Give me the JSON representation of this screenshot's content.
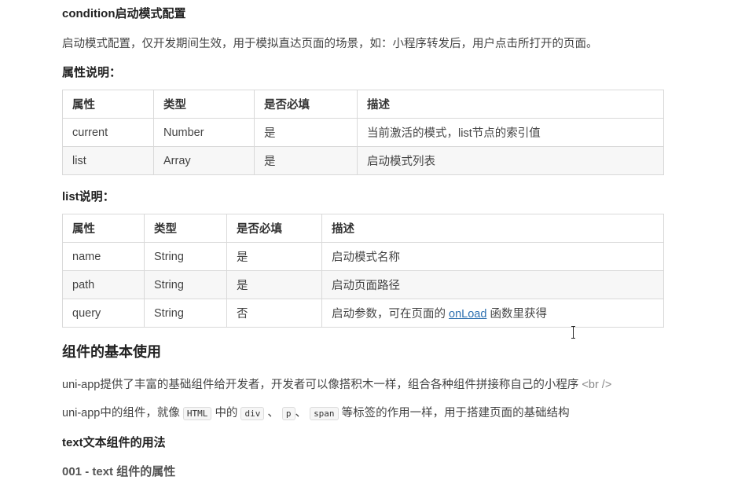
{
  "section1": {
    "title": "condition启动模式配置",
    "desc": "启动模式配置，仅开发期间生效，用于模拟直达页面的场景，如：小程序转发后，用户点击所打开的页面。",
    "attr_heading": "属性说明：",
    "table": {
      "headers": [
        "属性",
        "类型",
        "是否必填",
        "描述"
      ],
      "rows": [
        [
          "current",
          "Number",
          "是",
          "当前激活的模式，list节点的索引值"
        ],
        [
          "list",
          "Array",
          "是",
          "启动模式列表"
        ]
      ]
    }
  },
  "section2": {
    "heading": "list说明：",
    "table": {
      "headers": [
        "属性",
        "类型",
        "是否必填",
        "描述"
      ],
      "rows": [
        [
          "name",
          "String",
          "是",
          "启动模式名称"
        ],
        [
          "path",
          "String",
          "是",
          "启动页面路径"
        ],
        [
          "query",
          "String",
          "否",
          "启动参数，可在页面的",
          "onLoad",
          "函数里获得"
        ]
      ]
    }
  },
  "section3": {
    "title": "组件的基本使用",
    "para1": "uni-app提供了丰富的基础组件给开发者，开发者可以像搭积木一样，组合各种组件拼接称自己的小程序",
    "para1_tag": "<br />",
    "para2_a": "uni-app中的组件，就像",
    "code_html": "HTML",
    "para2_b": "中的",
    "code_div": "div",
    "sep1": "、",
    "code_p": "p",
    "sep2": "、",
    "code_span": "span",
    "para2_c": "等标签的作用一样，用于搭建页面的基础结构",
    "text_heading": "text文本组件的用法",
    "sub_heading": "001 - text 组件的属性"
  }
}
